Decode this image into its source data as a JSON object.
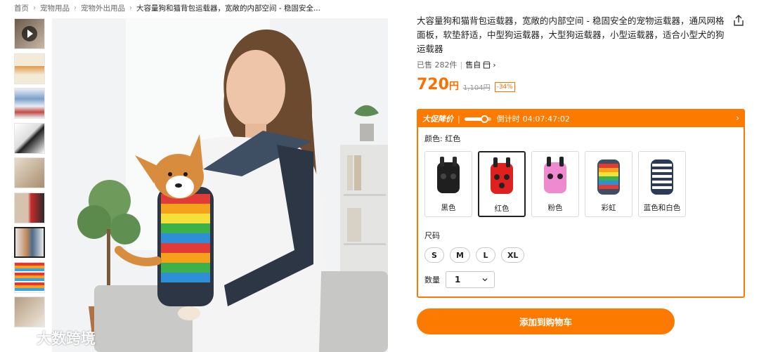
{
  "breadcrumb": [
    "首页",
    "宠物用品",
    "宠物外出用品",
    "大容量狗和猫背包运载器，宽敞的内部空间 - 稳固安全..."
  ],
  "product": {
    "title": "大容量狗和猫背包运载器，宽敞的内部空间 - 稳固安全的宠物运载器，通风网格面板，软垫舒适，中型狗运载器，大型狗运载器，小型运载器，适合小型犬的狗运载器",
    "sold": "已售 282件",
    "sold_sep": "|",
    "self_operated": "售自",
    "price": "720",
    "price_unit": "円",
    "old_price": "1,104円",
    "discount": "-34%"
  },
  "promo": {
    "label": "大促降价",
    "divider": "|",
    "countdown_label": "倒计时",
    "countdown": "04:07:47:02",
    "progress": 0.75
  },
  "color": {
    "label": "颜色: 红色",
    "options": [
      {
        "name": "黑色"
      },
      {
        "name": "红色"
      },
      {
        "name": "粉色"
      },
      {
        "name": "彩虹"
      },
      {
        "name": "蓝色和白色"
      }
    ]
  },
  "size": {
    "label": "尺码",
    "options": [
      "S",
      "M",
      "L",
      "XL"
    ]
  },
  "quantity": {
    "label": "数量",
    "value": "1"
  },
  "cart_button": "添加到购物车",
  "watermark": "大数跨境",
  "colors": {
    "accent": "#fd7a00",
    "price": "#fd6f01"
  }
}
